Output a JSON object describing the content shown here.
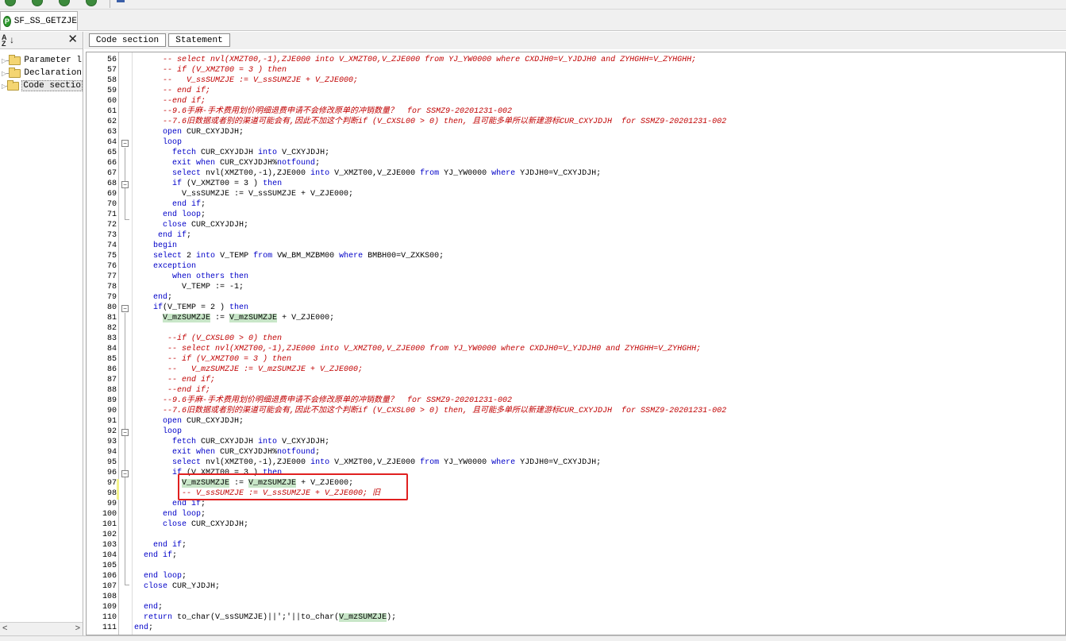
{
  "toolbar": {
    "button_icons": [
      "green-circle-icon",
      "green-circle-icon",
      "green-circle-icon",
      "green-circle-icon"
    ]
  },
  "document_tab": {
    "icon_letter": "P",
    "title": "SF_SS_GETZJE"
  },
  "navigator": {
    "sort_label_top": "A",
    "sort_label_bottom": "Z",
    "close_glyph": "✕",
    "items": [
      {
        "label": "Parameter l",
        "selected": false
      },
      {
        "label": "Declaration",
        "selected": false
      },
      {
        "label": "Code sectio",
        "selected": true
      }
    ]
  },
  "section_tabs": [
    {
      "label": "Code section"
    },
    {
      "label": "Statement"
    }
  ],
  "colors": {
    "keyword": "#0000c8",
    "comment": "#c00000",
    "highlight": "#c8e6c8",
    "annotation_box": "#e02020"
  },
  "editor": {
    "first_line_number": 56,
    "lines": [
      {
        "n": "56",
        "segs": [
          [
            "      ",
            ""
          ],
          [
            "-- select nvl(XMZT00,-1),ZJE000 into V_XMZT00,V_ZJE000 from YJ_YW0000 where CXDJH0=V_YJDJH0 and ZYHGHH=V_ZYHGHH;",
            "cm"
          ]
        ]
      },
      {
        "n": "57",
        "segs": [
          [
            "      ",
            ""
          ],
          [
            "-- if (V_XMZT00 = 3 ) then",
            "cm"
          ]
        ]
      },
      {
        "n": "58",
        "segs": [
          [
            "      ",
            ""
          ],
          [
            "--   V_ssSUMZJE := V_ssSUMZJE + V_ZJE000;",
            "cm"
          ]
        ]
      },
      {
        "n": "59",
        "segs": [
          [
            "      ",
            ""
          ],
          [
            "-- end if;",
            "cm"
          ]
        ]
      },
      {
        "n": "60",
        "segs": [
          [
            "      ",
            ""
          ],
          [
            "--end if;",
            "cm"
          ]
        ]
      },
      {
        "n": "61",
        "segs": [
          [
            "      ",
            ""
          ],
          [
            "--9.6手麻-手术费用划价明细退费申请不会修改原单的冲销数量？  for SSMZ9-20201231-002",
            "cm"
          ]
        ]
      },
      {
        "n": "62",
        "segs": [
          [
            "      ",
            ""
          ],
          [
            "--7.6旧数据或者别的渠道可能会有,因此不加这个判断if (V_CXSL00 > 0) then, 且可能多单所以新建游标CUR_CXYJDJH  for SSMZ9-20201231-002",
            "cm"
          ]
        ]
      },
      {
        "n": "63",
        "segs": [
          [
            "      ",
            ""
          ],
          [
            "open",
            "kw"
          ],
          [
            " CUR_CXYJDJH;",
            ""
          ]
        ]
      },
      {
        "n": "64",
        "segs": [
          [
            "      ",
            ""
          ],
          [
            "loop",
            "kw"
          ]
        ]
      },
      {
        "n": "65",
        "segs": [
          [
            "        ",
            ""
          ],
          [
            "fetch",
            "kw"
          ],
          [
            " CUR_CXYJDJH ",
            ""
          ],
          [
            "into",
            "kw"
          ],
          [
            " V_CXYJDJH;",
            ""
          ]
        ]
      },
      {
        "n": "66",
        "segs": [
          [
            "        ",
            ""
          ],
          [
            "exit when",
            "kw"
          ],
          [
            " CUR_CXYJDJH%",
            ""
          ],
          [
            "notfound",
            "kw"
          ],
          [
            ";",
            ""
          ]
        ]
      },
      {
        "n": "67",
        "segs": [
          [
            "        ",
            ""
          ],
          [
            "select",
            "kw"
          ],
          [
            " nvl(XMZT00,-1),ZJE000 ",
            ""
          ],
          [
            "into",
            "kw"
          ],
          [
            " V_XMZT00,V_ZJE000 ",
            ""
          ],
          [
            "from",
            "kw"
          ],
          [
            " YJ_YW0000 ",
            ""
          ],
          [
            "where",
            "kw"
          ],
          [
            " YJDJH0=V_CXYJDJH;",
            ""
          ]
        ]
      },
      {
        "n": "68",
        "segs": [
          [
            "        ",
            ""
          ],
          [
            "if",
            "kw"
          ],
          [
            " (V_XMZT00 = 3 ) ",
            ""
          ],
          [
            "then",
            "kw"
          ]
        ]
      },
      {
        "n": "69",
        "segs": [
          [
            "          V_ssSUMZJE := V_ssSUMZJE + V_ZJE000;",
            ""
          ]
        ]
      },
      {
        "n": "70",
        "segs": [
          [
            "        ",
            ""
          ],
          [
            "end if",
            "kw"
          ],
          [
            ";",
            ""
          ]
        ]
      },
      {
        "n": "71",
        "segs": [
          [
            "      ",
            ""
          ],
          [
            "end loop",
            "kw"
          ],
          [
            ";",
            ""
          ]
        ]
      },
      {
        "n": "72",
        "segs": [
          [
            "      ",
            ""
          ],
          [
            "close",
            "kw"
          ],
          [
            " CUR_CXYJDJH;",
            ""
          ]
        ]
      },
      {
        "n": "73",
        "segs": [
          [
            "     ",
            ""
          ],
          [
            "end if",
            "kw"
          ],
          [
            ";",
            ""
          ]
        ]
      },
      {
        "n": "74",
        "segs": [
          [
            "    ",
            ""
          ],
          [
            "begin",
            "kw"
          ]
        ]
      },
      {
        "n": "75",
        "segs": [
          [
            "    ",
            ""
          ],
          [
            "select",
            "kw"
          ],
          [
            " 2 ",
            ""
          ],
          [
            "into",
            "kw"
          ],
          [
            " V_TEMP ",
            ""
          ],
          [
            "from",
            "kw"
          ],
          [
            " VW_BM_MZBM00 ",
            ""
          ],
          [
            "where",
            "kw"
          ],
          [
            " BMBH00=V_ZXKS00;",
            ""
          ]
        ]
      },
      {
        "n": "76",
        "segs": [
          [
            "    ",
            ""
          ],
          [
            "exception",
            "kw"
          ]
        ]
      },
      {
        "n": "77",
        "segs": [
          [
            "        ",
            ""
          ],
          [
            "when others then",
            "kw"
          ]
        ]
      },
      {
        "n": "78",
        "segs": [
          [
            "          V_TEMP := -1;",
            ""
          ]
        ]
      },
      {
        "n": "79",
        "segs": [
          [
            "    ",
            ""
          ],
          [
            "end",
            "kw"
          ],
          [
            ";",
            ""
          ]
        ]
      },
      {
        "n": "80",
        "segs": [
          [
            "    ",
            ""
          ],
          [
            "if",
            "kw"
          ],
          [
            "(V_TEMP = 2 ) ",
            ""
          ],
          [
            "then",
            "kw"
          ]
        ]
      },
      {
        "n": "81",
        "segs": [
          [
            "      ",
            ""
          ],
          [
            "V_mzSUMZJE",
            "hl"
          ],
          [
            " := ",
            ""
          ],
          [
            "V_mzSUMZJE",
            "hl"
          ],
          [
            " + V_ZJE000;",
            ""
          ]
        ]
      },
      {
        "n": "82",
        "segs": [
          [
            "",
            ""
          ]
        ]
      },
      {
        "n": "83",
        "segs": [
          [
            "       ",
            ""
          ],
          [
            "--if (V_CXSL00 > 0) then",
            "cm"
          ]
        ]
      },
      {
        "n": "84",
        "segs": [
          [
            "       ",
            ""
          ],
          [
            "-- select nvl(XMZT00,-1),ZJE000 into V_XMZT00,V_ZJE000 from YJ_YW0000 where CXDJH0=V_YJDJH0 and ZYHGHH=V_ZYHGHH;",
            "cm"
          ]
        ]
      },
      {
        "n": "85",
        "segs": [
          [
            "       ",
            ""
          ],
          [
            "-- if (V_XMZT00 = 3 ) then",
            "cm"
          ]
        ]
      },
      {
        "n": "86",
        "segs": [
          [
            "       ",
            ""
          ],
          [
            "--   V_mzSUMZJE := V_mzSUMZJE + V_ZJE000;",
            "cm"
          ]
        ]
      },
      {
        "n": "87",
        "segs": [
          [
            "       ",
            ""
          ],
          [
            "-- end if;",
            "cm"
          ]
        ]
      },
      {
        "n": "88",
        "segs": [
          [
            "       ",
            ""
          ],
          [
            "--end if;",
            "cm"
          ]
        ]
      },
      {
        "n": "89",
        "segs": [
          [
            "      ",
            ""
          ],
          [
            "--9.6手麻-手术费用划价明细退费申请不会修改原单的冲销数量？  for SSMZ9-20201231-002",
            "cm"
          ]
        ]
      },
      {
        "n": "90",
        "segs": [
          [
            "      ",
            ""
          ],
          [
            "--7.6旧数据或者别的渠道可能会有,因此不加这个判断if (V_CXSL00 > 0) then, 且可能多单所以新建游标CUR_CXYJDJH  for SSMZ9-20201231-002",
            "cm"
          ]
        ]
      },
      {
        "n": "91",
        "segs": [
          [
            "      ",
            ""
          ],
          [
            "open",
            "kw"
          ],
          [
            " CUR_CXYJDJH;",
            ""
          ]
        ]
      },
      {
        "n": "92",
        "segs": [
          [
            "      ",
            ""
          ],
          [
            "loop",
            "kw"
          ]
        ]
      },
      {
        "n": "93",
        "segs": [
          [
            "        ",
            ""
          ],
          [
            "fetch",
            "kw"
          ],
          [
            " CUR_CXYJDJH ",
            ""
          ],
          [
            "into",
            "kw"
          ],
          [
            " V_CXYJDJH;",
            ""
          ]
        ]
      },
      {
        "n": "94",
        "segs": [
          [
            "        ",
            ""
          ],
          [
            "exit when",
            "kw"
          ],
          [
            " CUR_CXYJDJH%",
            ""
          ],
          [
            "notfound",
            "kw"
          ],
          [
            ";",
            ""
          ]
        ]
      },
      {
        "n": "95",
        "segs": [
          [
            "        ",
            ""
          ],
          [
            "select",
            "kw"
          ],
          [
            " nvl(XMZT00,-1),ZJE000 ",
            ""
          ],
          [
            "into",
            "kw"
          ],
          [
            " V_XMZT00,V_ZJE000 ",
            ""
          ],
          [
            "from",
            "kw"
          ],
          [
            " YJ_YW0000 ",
            ""
          ],
          [
            "where",
            "kw"
          ],
          [
            " YJDJH0=V_CXYJDJH;",
            ""
          ]
        ]
      },
      {
        "n": "96",
        "segs": [
          [
            "        ",
            ""
          ],
          [
            "if",
            "kw"
          ],
          [
            " (V_XMZT00 = 3 ) ",
            ""
          ],
          [
            "then",
            "kw"
          ]
        ]
      },
      {
        "n": "97",
        "segs": [
          [
            "          ",
            ""
          ],
          [
            "V_mzSUMZJE",
            "hl"
          ],
          [
            " := ",
            ""
          ],
          [
            "V_mzSUMZJE",
            "hl"
          ],
          [
            " + V_ZJE000;",
            ""
          ]
        ]
      },
      {
        "n": "98",
        "segs": [
          [
            "          ",
            ""
          ],
          [
            "-- V_ssSUMZJE := V_ssSUMZJE + V_ZJE000; 旧",
            "cm"
          ]
        ]
      },
      {
        "n": "99",
        "segs": [
          [
            "        ",
            ""
          ],
          [
            "end if",
            "kw"
          ],
          [
            ";",
            ""
          ]
        ]
      },
      {
        "n": "100",
        "segs": [
          [
            "      ",
            ""
          ],
          [
            "end loop",
            "kw"
          ],
          [
            ";",
            ""
          ]
        ]
      },
      {
        "n": "101",
        "segs": [
          [
            "      ",
            ""
          ],
          [
            "close",
            "kw"
          ],
          [
            " CUR_CXYJDJH;",
            ""
          ]
        ]
      },
      {
        "n": "102",
        "segs": [
          [
            "",
            ""
          ]
        ]
      },
      {
        "n": "103",
        "segs": [
          [
            "    ",
            ""
          ],
          [
            "end if",
            "kw"
          ],
          [
            ";",
            ""
          ]
        ]
      },
      {
        "n": "104",
        "segs": [
          [
            "  ",
            ""
          ],
          [
            "end if",
            "kw"
          ],
          [
            ";",
            ""
          ]
        ]
      },
      {
        "n": "105",
        "segs": [
          [
            "",
            ""
          ]
        ]
      },
      {
        "n": "106",
        "segs": [
          [
            "  ",
            ""
          ],
          [
            "end loop",
            "kw"
          ],
          [
            ";",
            ""
          ]
        ]
      },
      {
        "n": "107",
        "segs": [
          [
            "  ",
            ""
          ],
          [
            "close",
            "kw"
          ],
          [
            " CUR_YJDJH;",
            ""
          ]
        ]
      },
      {
        "n": "108",
        "segs": [
          [
            "",
            ""
          ]
        ]
      },
      {
        "n": "109",
        "segs": [
          [
            "  ",
            ""
          ],
          [
            "end",
            "kw"
          ],
          [
            ";",
            ""
          ]
        ]
      },
      {
        "n": "110",
        "segs": [
          [
            "  ",
            ""
          ],
          [
            "return",
            "kw"
          ],
          [
            " to_char(V_ssSUMZJE)||';'||to_char(",
            ""
          ],
          [
            "V_mzSUMZJE",
            "hl"
          ],
          [
            ");",
            ""
          ]
        ]
      },
      {
        "n": "111",
        "segs": [
          [
            "",
            ""
          ],
          [
            "end",
            "kw"
          ],
          [
            ";",
            ""
          ]
        ]
      }
    ]
  }
}
